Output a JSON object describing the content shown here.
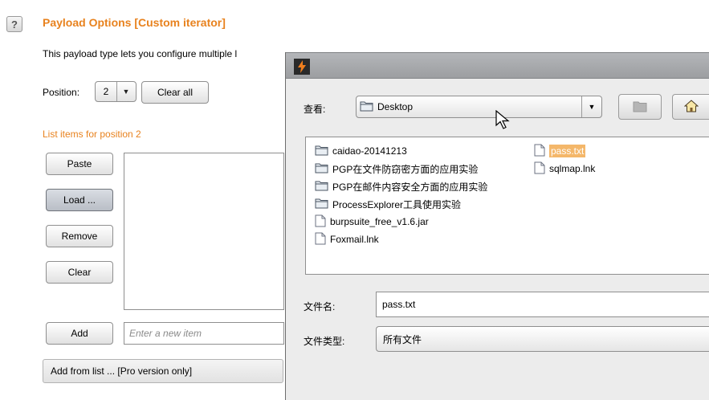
{
  "panel": {
    "title": "Payload Options [Custom iterator]",
    "description": "This payload type lets you configure multiple l",
    "position_label": "Position:",
    "position_value": "2",
    "clear_all": "Clear all",
    "list_label": "List items for position 2",
    "buttons": {
      "paste": "Paste",
      "load": "Load ...",
      "remove": "Remove",
      "clear": "Clear",
      "add": "Add"
    },
    "new_item_placeholder": "Enter a new item",
    "add_from_list": "Add from list ... [Pro version only]"
  },
  "dialog": {
    "look_in_label": "查看:",
    "look_in_value": "Desktop",
    "files_col1": [
      {
        "name": "caidao-20141213",
        "icon": "folder-icon"
      },
      {
        "name": "PGP在文件防窃密方面的应用实验",
        "icon": "folder-icon"
      },
      {
        "name": "PGP在邮件内容安全方面的应用实验",
        "icon": "folder-icon"
      },
      {
        "name": "ProcessExplorer工具使用实验",
        "icon": "folder-icon"
      },
      {
        "name": "burpsuite_free_v1.6.jar",
        "icon": "file-icon"
      },
      {
        "name": "Foxmail.lnk",
        "icon": "file-icon"
      }
    ],
    "files_col2": [
      {
        "name": "pass.txt",
        "icon": "file-icon",
        "selected": true
      },
      {
        "name": "sqlmap.lnk",
        "icon": "file-icon"
      }
    ],
    "filename_label": "文件名:",
    "filename_value": "pass.txt",
    "filetype_label": "文件类型:",
    "filetype_value": "所有文件"
  },
  "colors": {
    "accent": "#e8821e",
    "selection": "#f4b76a"
  }
}
